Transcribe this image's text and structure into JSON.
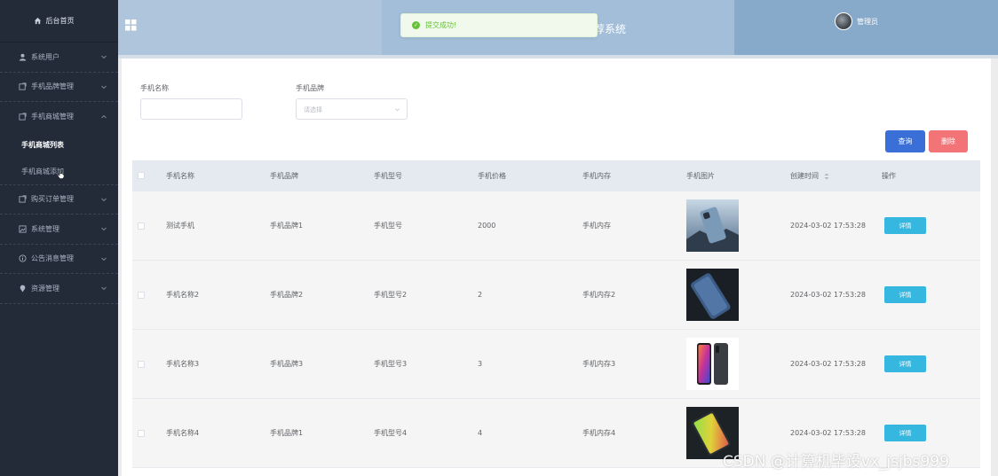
{
  "sidebar": {
    "home_label": "后台首页",
    "items": [
      {
        "label": "系统用户",
        "icon": "user-icon"
      },
      {
        "label": "手机品牌管理",
        "icon": "document-icon"
      },
      {
        "label": "手机商城管理",
        "icon": "document-icon",
        "expanded": true,
        "children": [
          {
            "label": "手机商城列表",
            "active": true
          },
          {
            "label": "手机商城添加",
            "active": false
          }
        ]
      },
      {
        "label": "购买订单管理",
        "icon": "document-icon"
      },
      {
        "label": "系统管理",
        "icon": "image-icon"
      },
      {
        "label": "公告消息管理",
        "icon": "info-icon"
      },
      {
        "label": "资源管理",
        "icon": "location-icon"
      }
    ]
  },
  "header": {
    "title_visible": "荐系统",
    "user": "管理员"
  },
  "toast": {
    "message": "提交成功!",
    "type": "success",
    "color": "#67c23a"
  },
  "search": {
    "name_label": "手机名称",
    "name_value": "",
    "brand_label": "手机品牌",
    "brand_placeholder": "请选择",
    "query_button": "查询",
    "delete_button": "删除"
  },
  "table": {
    "columns": [
      "手机名称",
      "手机品牌",
      "手机型号",
      "手机价格",
      "手机内存",
      "手机图片",
      "创建时间",
      "操作"
    ],
    "rows": [
      {
        "name": "测试手机",
        "brand": "手机品牌1",
        "model": "手机型号",
        "price": "2000",
        "memory": "手机内存",
        "image": "phone-back-blue",
        "created": "2024-03-02 17:53:28",
        "action": "详情"
      },
      {
        "name": "手机名称2",
        "brand": "手机品牌2",
        "model": "手机型号2",
        "price": "2",
        "memory": "手机内存2",
        "image": "phone-dark-blue",
        "created": "2024-03-02 17:53:28",
        "action": "详情"
      },
      {
        "name": "手机名称3",
        "brand": "手机品牌3",
        "model": "手机型号3",
        "price": "3",
        "memory": "手机内存3",
        "image": "phone-pair",
        "created": "2024-03-02 17:53:28",
        "action": "详情"
      },
      {
        "name": "手机名称4",
        "brand": "手机品牌1",
        "model": "手机型号4",
        "price": "4",
        "memory": "手机内存4",
        "image": "phone-colorful",
        "created": "2024-03-02 17:53:28",
        "action": "详情"
      }
    ]
  },
  "watermark": "CSDN @计算机毕设vx_jsjbs999",
  "colors": {
    "sidebar_bg": "#232b39",
    "header_bg": "#aec5dc",
    "primary": "#3a6fd8",
    "danger": "#f27477",
    "info": "#35b7e0"
  }
}
